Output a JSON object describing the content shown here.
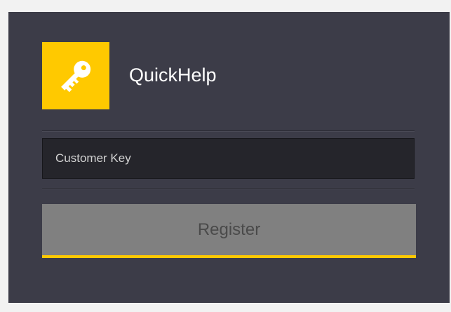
{
  "app": {
    "title": "QuickHelp",
    "logo_icon": "key-icon"
  },
  "form": {
    "customer_key_placeholder": "Customer Key",
    "customer_key_value": "",
    "register_label": "Register"
  },
  "colors": {
    "window_background": "#3c3c48",
    "accent": "#ffc900",
    "input_background": "#25252b",
    "button_background": "#808080",
    "button_text": "#4a4a4a"
  }
}
